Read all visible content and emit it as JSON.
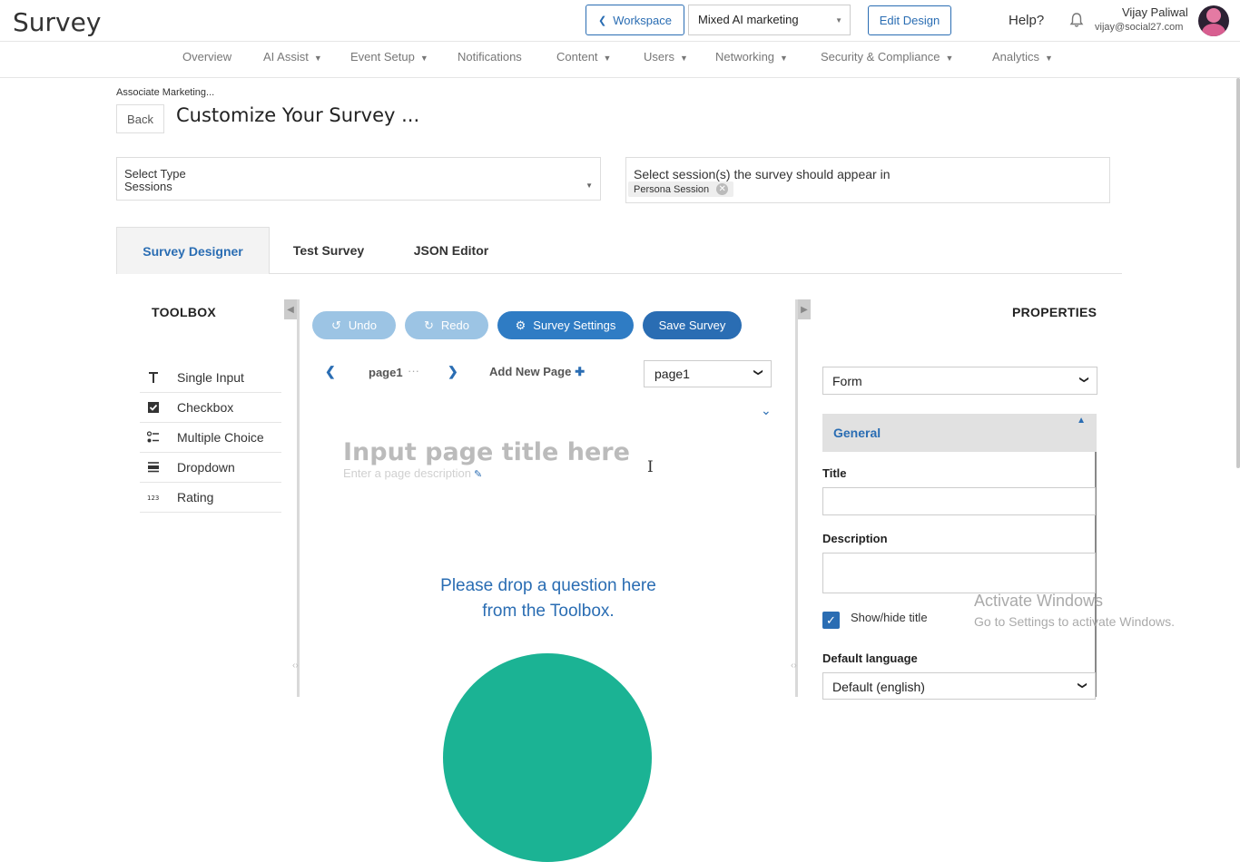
{
  "header": {
    "app_title": "Survey",
    "workspace_button": "Workspace",
    "workspace_select": "Mixed AI marketing",
    "edit_design_button": "Edit Design",
    "help": "Help?",
    "user_name": "Vijay Paliwal",
    "user_email": "vijay@social27.com"
  },
  "nav": {
    "items": [
      "Overview",
      "AI Assist",
      "Event Setup",
      "Notifications",
      "Content",
      "Users",
      "Networking",
      "Security & Compliance",
      "Analytics"
    ]
  },
  "page": {
    "breadcrumb": "Associate Marketing...",
    "back_button": "Back",
    "title": "Customize Your Survey ..."
  },
  "filters": {
    "type_label": "Select Type",
    "type_value": "Sessions",
    "sessions_label": "Select session(s) the survey should appear in",
    "session_chip": "Persona Session"
  },
  "tabs": [
    "Survey Designer",
    "Test Survey",
    "JSON Editor"
  ],
  "toolbox": {
    "title": "TOOLBOX",
    "items": [
      "Single Input",
      "Checkbox",
      "Multiple Choice",
      "Dropdown",
      "Rating"
    ]
  },
  "designer": {
    "undo": "Undo",
    "redo": "Redo",
    "survey_settings": "Survey Settings",
    "save_survey": "Save Survey",
    "page_label": "page1",
    "page_dots": "···",
    "add_new_page": "Add New Page",
    "page_select": "page1",
    "page_title_placeholder": "Input page title here",
    "page_description_placeholder": "Enter a page description",
    "drop_hint_line1": "Please drop a question here",
    "drop_hint_line2": "from the Toolbox."
  },
  "properties": {
    "title": "PROPERTIES",
    "object_select": "Form",
    "section": "General",
    "title_label": "Title",
    "description_label": "Description",
    "show_hide_title": "Show/hide title",
    "default_language_label": "Default language",
    "default_language_value": "Default (english)"
  },
  "watermark": {
    "title": "Activate Windows",
    "subtitle": "Go to Settings to activate Windows."
  },
  "colors": {
    "accent": "#2a6db3",
    "accent_light": "#9cc4e4",
    "green": "#1bb394"
  }
}
